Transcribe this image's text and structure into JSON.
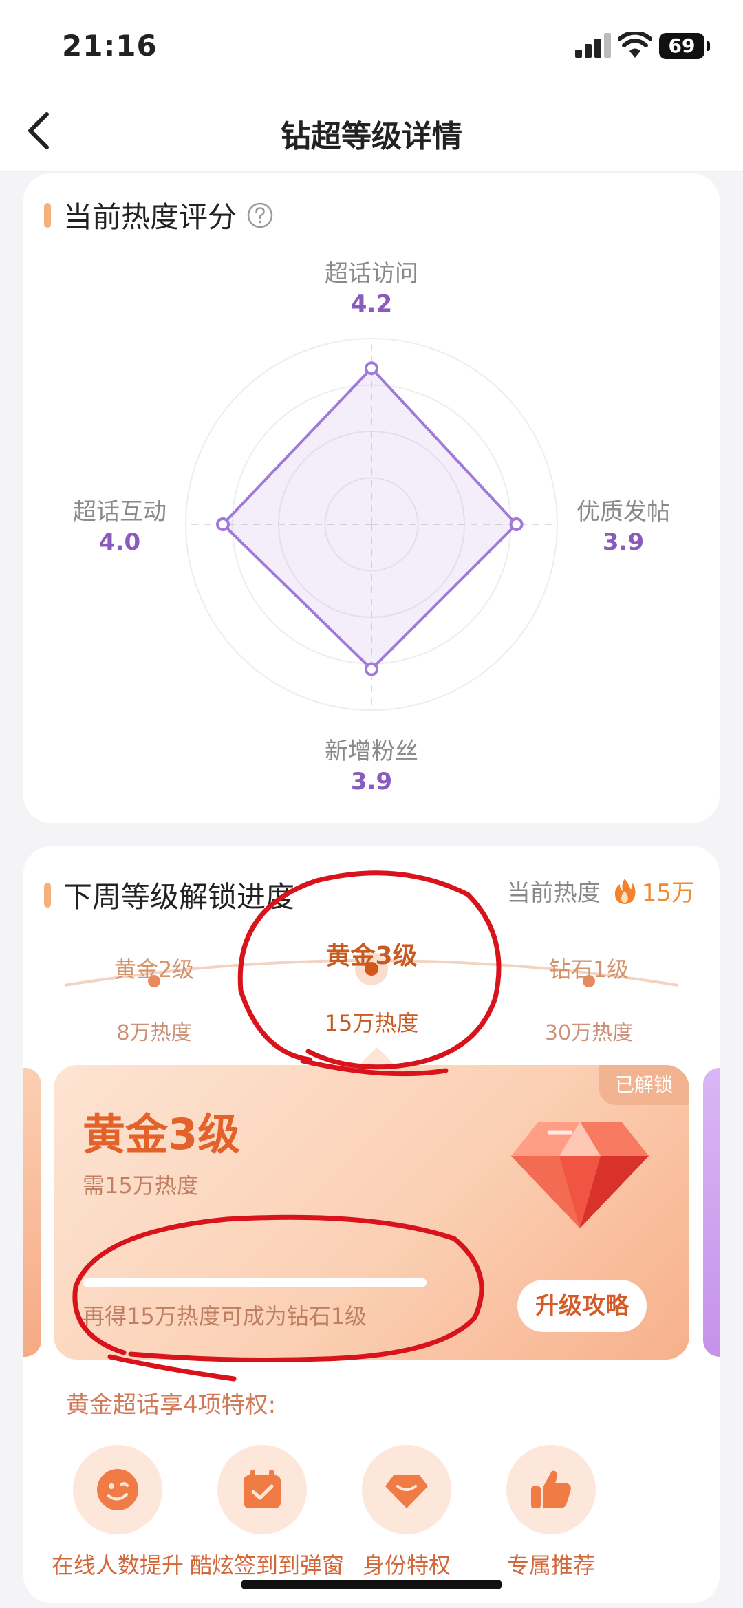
{
  "status_bar": {
    "time": "21:16",
    "battery": "69"
  },
  "nav": {
    "title": "钻超等级详情"
  },
  "radar_section": {
    "title": "当前热度评分",
    "axes": [
      {
        "label": "超话访问",
        "value": "4.2"
      },
      {
        "label": "优质发帖",
        "value": "3.9"
      },
      {
        "label": "新增粉丝",
        "value": "3.9"
      },
      {
        "label": "超话互动",
        "value": "4.0"
      }
    ]
  },
  "chart_data": {
    "type": "radar",
    "axes": [
      "超话访问",
      "优质发帖",
      "新增粉丝",
      "超话互动"
    ],
    "values": [
      4.2,
      3.9,
      3.9,
      4.0
    ],
    "range": [
      0,
      5
    ],
    "rings": 4,
    "color": "#a07ad8"
  },
  "progress_section": {
    "title": "下周等级解锁进度",
    "current_heat_label": "当前热度",
    "current_heat_value": "15万",
    "levels": [
      {
        "name": "黄金2级",
        "heat": "8万热度"
      },
      {
        "name": "黄金3级",
        "heat": "15万热度"
      },
      {
        "name": "钻石1级",
        "heat": "30万热度"
      }
    ],
    "active_index": 1
  },
  "level_card": {
    "badge": "已解锁",
    "name": "黄金3级",
    "need": "需15万热度",
    "progress": 1.0,
    "tip": "再得15万热度可成为钻石1级",
    "guide_button": "升级攻略"
  },
  "privileges": {
    "title": "黄金超话享4项特权:",
    "items": [
      {
        "label": "在线人数提升",
        "icon": "smile-face-icon"
      },
      {
        "label": "酷炫签到到弹窗",
        "icon": "calendar-check-icon"
      },
      {
        "label": "身份特权",
        "icon": "gem-icon"
      },
      {
        "label": "专属推荐",
        "icon": "thumbs-up-icon"
      }
    ]
  },
  "colors": {
    "accent_orange": "#e2622a",
    "radar_purple": "#a07ad8",
    "ink_red": "#d8131c"
  }
}
